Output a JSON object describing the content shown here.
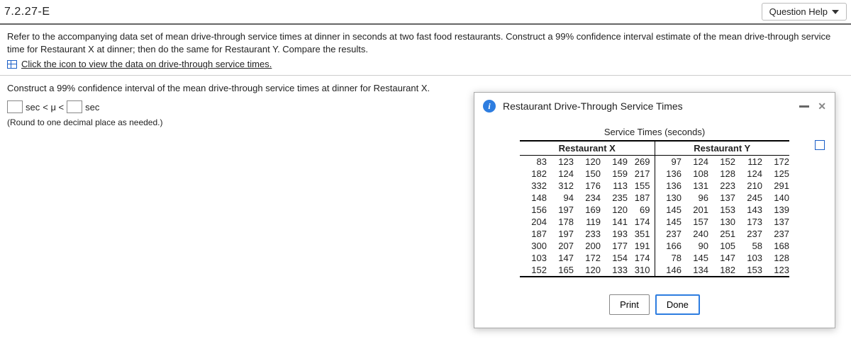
{
  "header": {
    "question_number": "7.2.27-E",
    "help_label": "Question Help"
  },
  "problem": {
    "text": "Refer to the accompanying data set of mean drive-through service times at dinner in seconds at two fast food restaurants. Construct a 99% confidence interval estimate of the mean drive-through service time for Restaurant X at dinner; then do the same for Restaurant Y. Compare the results.",
    "data_link": "Click the icon to view the data on drive-through service times."
  },
  "sub_instruction": "Construct a 99% confidence interval of the mean drive-through service times at dinner for Restaurant X.",
  "answer": {
    "unit_before": "sec",
    "operator": "< μ <",
    "unit_after": "sec",
    "round_note": "(Round to one decimal place as needed.)"
  },
  "popup": {
    "title": "Restaurant Drive-Through Service Times",
    "caption": "Service Times (seconds)",
    "col_group_x": "Restaurant X",
    "col_group_y": "Restaurant Y",
    "print_label": "Print",
    "done_label": "Done"
  },
  "chart_data": {
    "type": "table",
    "title": "Service Times (seconds)",
    "groups": [
      "Restaurant X",
      "Restaurant Y"
    ],
    "restaurant_x": [
      [
        83,
        123,
        120,
        149,
        269
      ],
      [
        182,
        124,
        150,
        159,
        217
      ],
      [
        332,
        312,
        176,
        113,
        155
      ],
      [
        148,
        94,
        234,
        235,
        187
      ],
      [
        156,
        197,
        169,
        120,
        69
      ],
      [
        204,
        178,
        119,
        141,
        174
      ],
      [
        187,
        197,
        233,
        193,
        351
      ],
      [
        300,
        207,
        200,
        177,
        191
      ],
      [
        103,
        147,
        172,
        154,
        174
      ],
      [
        152,
        165,
        120,
        133,
        310
      ]
    ],
    "restaurant_y": [
      [
        97,
        124,
        152,
        112,
        172
      ],
      [
        136,
        108,
        128,
        124,
        125
      ],
      [
        136,
        131,
        223,
        210,
        291
      ],
      [
        130,
        96,
        137,
        245,
        140
      ],
      [
        145,
        201,
        153,
        143,
        139
      ],
      [
        145,
        157,
        130,
        173,
        137
      ],
      [
        237,
        240,
        251,
        237,
        237
      ],
      [
        166,
        90,
        105,
        58,
        168
      ],
      [
        78,
        145,
        147,
        103,
        128
      ],
      [
        146,
        134,
        182,
        153,
        123
      ]
    ]
  }
}
